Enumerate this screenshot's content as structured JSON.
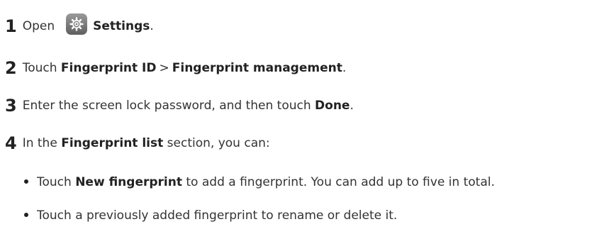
{
  "steps": [
    {
      "number": "1",
      "parts": [
        "Open",
        "Settings",
        "."
      ]
    },
    {
      "number": "2",
      "parts": [
        "Touch",
        "Fingerprint ID",
        ">",
        "Fingerprint management",
        "."
      ]
    },
    {
      "number": "3",
      "parts": [
        "Enter the screen lock password, and then touch",
        "Done",
        "."
      ]
    },
    {
      "number": "4",
      "parts": [
        "In the",
        "Fingerprint list",
        "section, you can:"
      ]
    }
  ],
  "bullets": [
    {
      "parts": [
        "Touch",
        "New fingerprint",
        "to add a fingerprint. You can add up to five in total."
      ]
    },
    {
      "parts": [
        "Touch a previously added fingerprint to rename or delete it."
      ]
    }
  ],
  "icons": {
    "settings": "gear-icon"
  }
}
